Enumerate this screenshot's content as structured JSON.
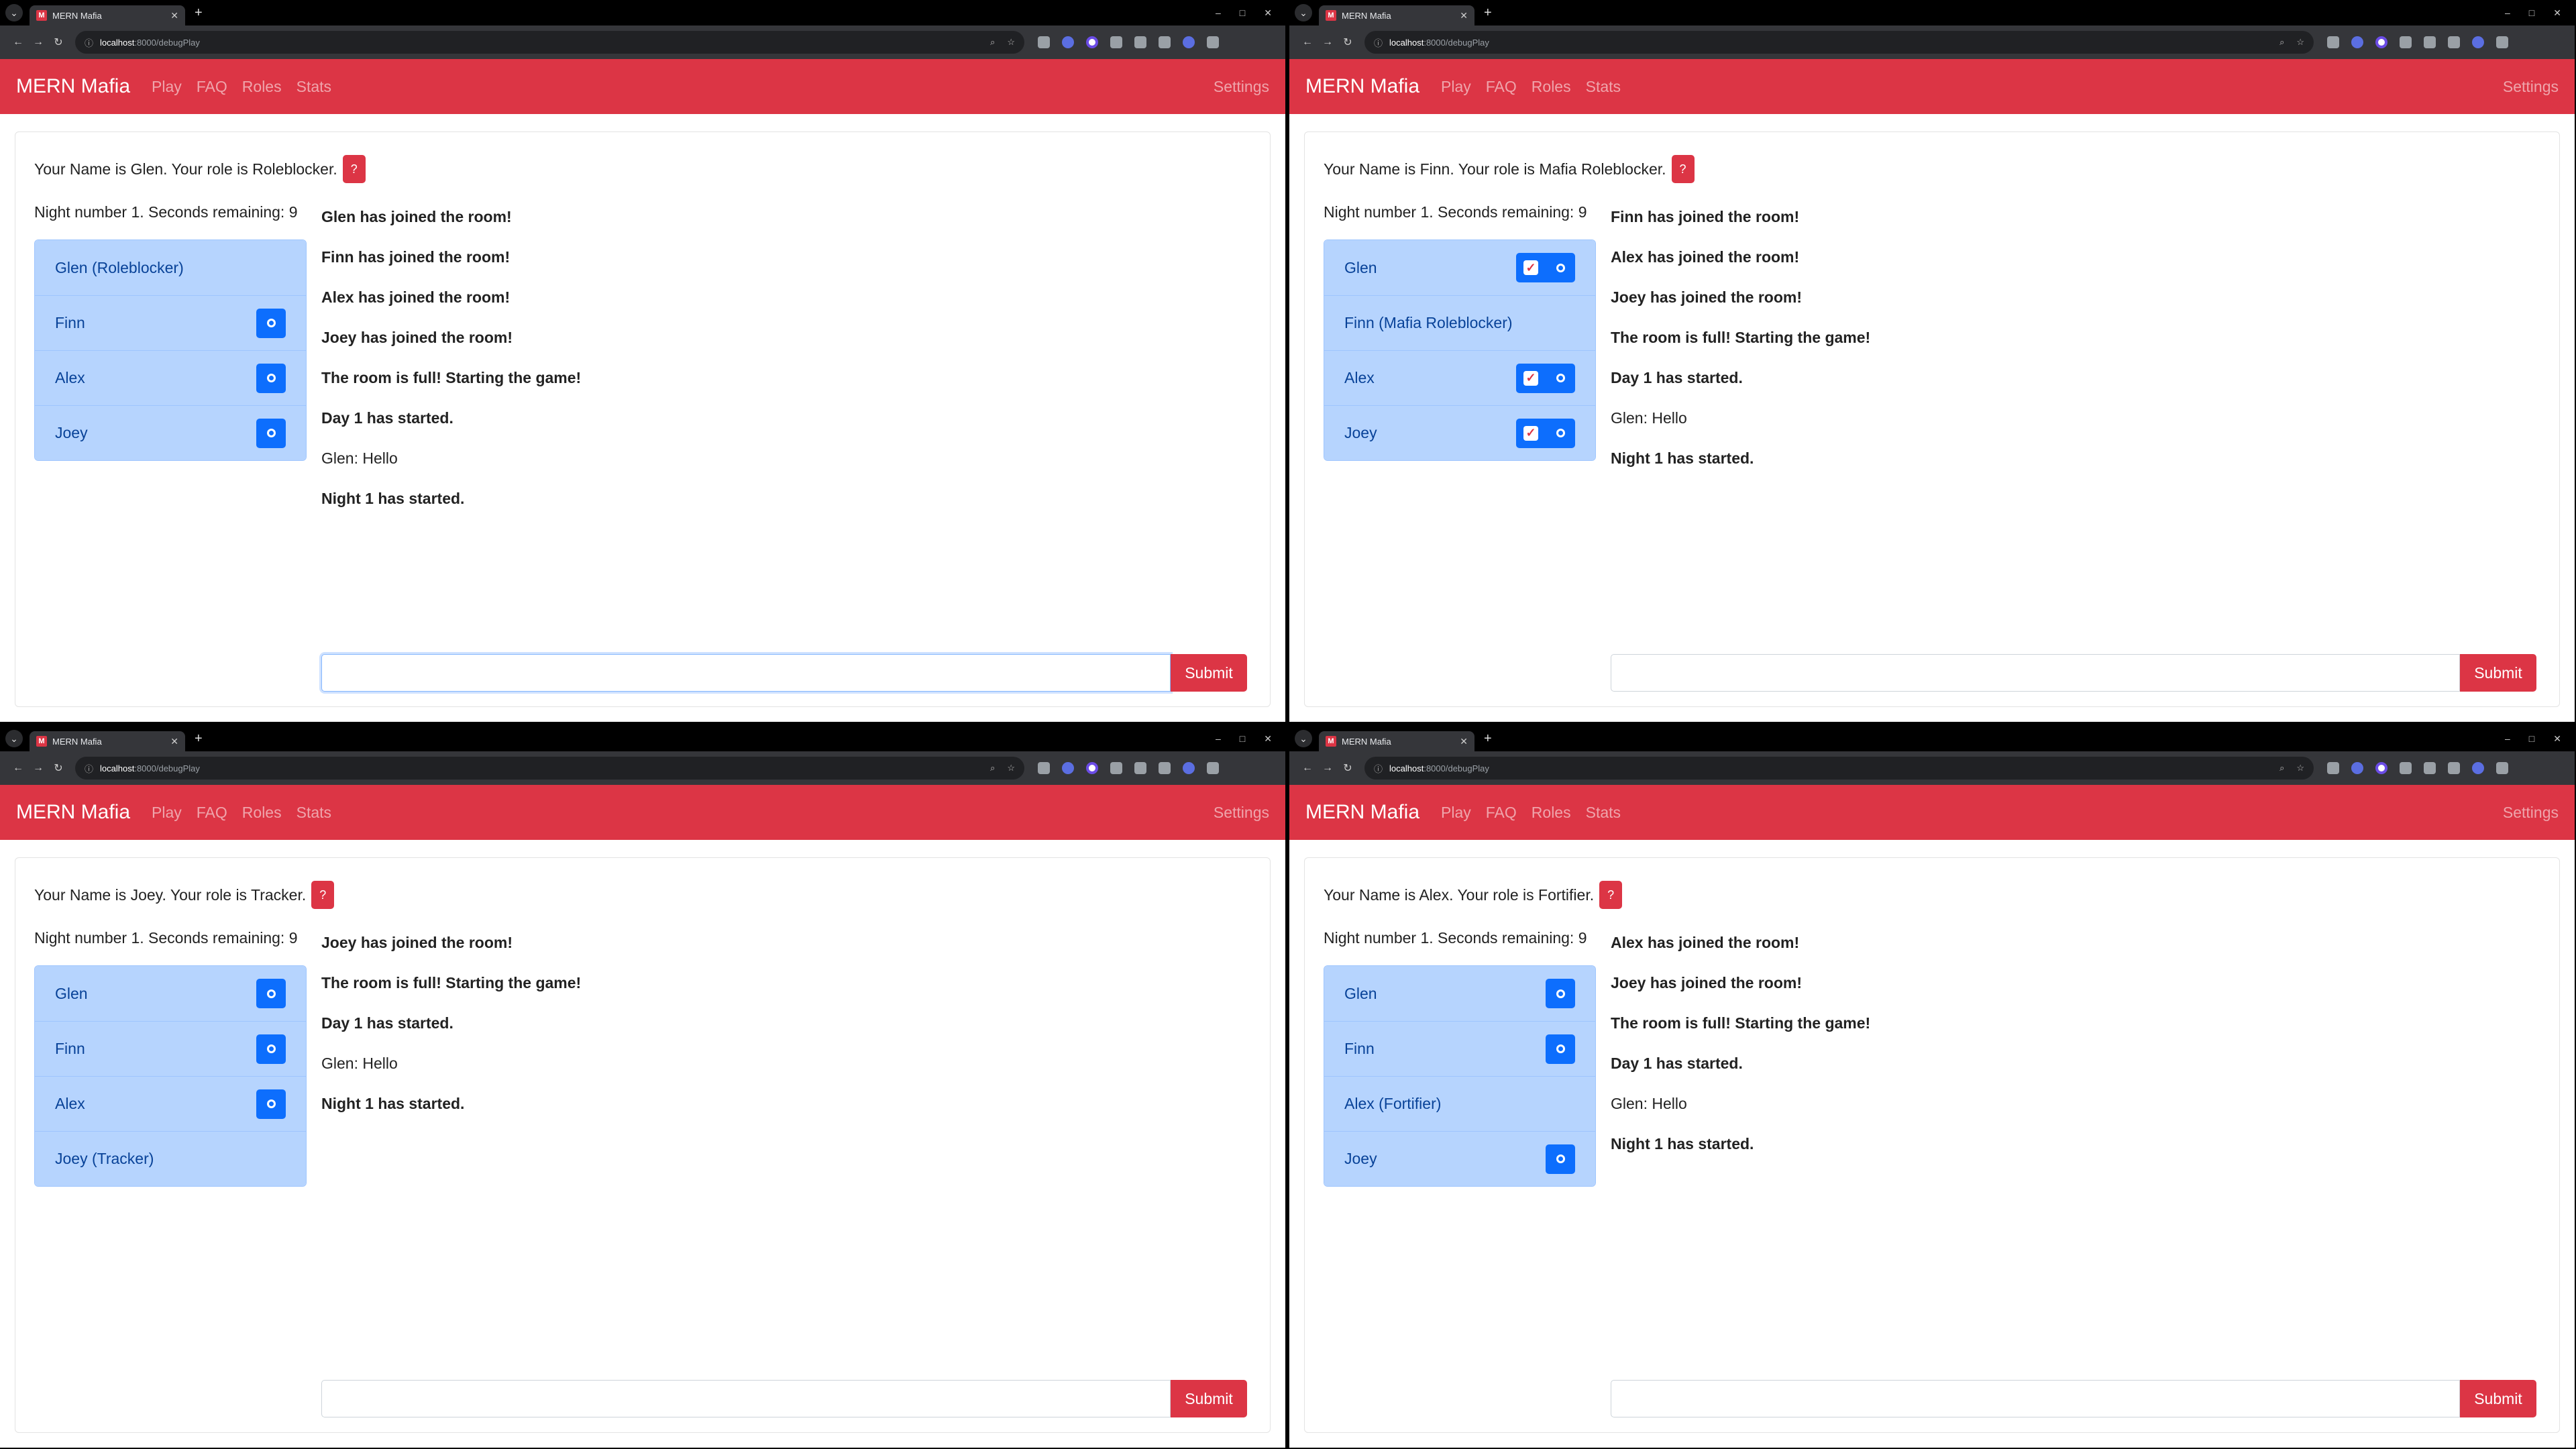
{
  "browser": {
    "tab_title": "MERN Mafia",
    "favicon_letter": "M",
    "url_host": "localhost",
    "url_path": ":8000/debugPlay",
    "new_tab_label": "+",
    "window_controls": [
      "–",
      "□",
      "✕"
    ]
  },
  "app": {
    "brand": "MERN Mafia",
    "nav": [
      "Play",
      "FAQ",
      "Roles",
      "Stats"
    ],
    "settings": "Settings",
    "help_label": "?",
    "submit_label": "Submit"
  },
  "windows": [
    {
      "role_text": "Your Name is Glen. Your role is Roleblocker.",
      "timer_text": "Night number 1. Seconds remaining: 9",
      "players": [
        {
          "name": "Glen (Roleblocker)",
          "buttons": []
        },
        {
          "name": "Finn",
          "buttons": [
            "target"
          ]
        },
        {
          "name": "Alex",
          "buttons": [
            "target"
          ]
        },
        {
          "name": "Joey",
          "buttons": [
            "target"
          ]
        }
      ],
      "messages": [
        {
          "text": "Glen has joined the room!",
          "bold": true
        },
        {
          "text": "Finn has joined the room!",
          "bold": true
        },
        {
          "text": "Alex has joined the room!",
          "bold": true
        },
        {
          "text": "Joey has joined the room!",
          "bold": true
        },
        {
          "text": "The room is full! Starting the game!",
          "bold": true
        },
        {
          "text": "Day 1 has started.",
          "bold": true
        },
        {
          "text": "Glen: Hello",
          "bold": false
        },
        {
          "text": "Night 1 has started.",
          "bold": true
        }
      ],
      "input_value": "",
      "input_focused": true
    },
    {
      "role_text": "Your Name is Finn. Your role is Mafia Roleblocker.",
      "timer_text": "Night number 1. Seconds remaining: 9",
      "players": [
        {
          "name": "Glen",
          "buttons": [
            "vote",
            "target"
          ]
        },
        {
          "name": "Finn (Mafia Roleblocker)",
          "buttons": []
        },
        {
          "name": "Alex",
          "buttons": [
            "vote",
            "target"
          ]
        },
        {
          "name": "Joey",
          "buttons": [
            "vote",
            "target"
          ]
        }
      ],
      "messages": [
        {
          "text": "Finn has joined the room!",
          "bold": true
        },
        {
          "text": "Alex has joined the room!",
          "bold": true
        },
        {
          "text": "Joey has joined the room!",
          "bold": true
        },
        {
          "text": "The room is full! Starting the game!",
          "bold": true
        },
        {
          "text": "Day 1 has started.",
          "bold": true
        },
        {
          "text": "Glen: Hello",
          "bold": false
        },
        {
          "text": "Night 1 has started.",
          "bold": true
        }
      ],
      "input_value": "",
      "input_focused": false
    },
    {
      "role_text": "Your Name is Joey. Your role is Tracker.",
      "timer_text": "Night number 1. Seconds remaining: 9",
      "players": [
        {
          "name": "Glen",
          "buttons": [
            "target"
          ]
        },
        {
          "name": "Finn",
          "buttons": [
            "target"
          ]
        },
        {
          "name": "Alex",
          "buttons": [
            "target"
          ]
        },
        {
          "name": "Joey (Tracker)",
          "buttons": []
        }
      ],
      "messages": [
        {
          "text": "Joey has joined the room!",
          "bold": true
        },
        {
          "text": "The room is full! Starting the game!",
          "bold": true
        },
        {
          "text": "Day 1 has started.",
          "bold": true
        },
        {
          "text": "Glen: Hello",
          "bold": false
        },
        {
          "text": "Night 1 has started.",
          "bold": true
        }
      ],
      "input_value": "",
      "input_focused": false
    },
    {
      "role_text": "Your Name is Alex. Your role is Fortifier.",
      "timer_text": "Night number 1. Seconds remaining: 9",
      "players": [
        {
          "name": "Glen",
          "buttons": [
            "target"
          ]
        },
        {
          "name": "Finn",
          "buttons": [
            "target"
          ]
        },
        {
          "name": "Alex (Fortifier)",
          "buttons": []
        },
        {
          "name": "Joey",
          "buttons": [
            "target"
          ]
        }
      ],
      "messages": [
        {
          "text": "Alex has joined the room!",
          "bold": true
        },
        {
          "text": "Joey has joined the room!",
          "bold": true
        },
        {
          "text": "The room is full! Starting the game!",
          "bold": true
        },
        {
          "text": "Day 1 has started.",
          "bold": true
        },
        {
          "text": "Glen: Hello",
          "bold": false
        },
        {
          "text": "Night 1 has started.",
          "bold": true
        }
      ],
      "input_value": "",
      "input_focused": false
    }
  ],
  "colors": {
    "brand_red": "#dc3545",
    "player_bg": "#b6d4fe",
    "button_blue": "#0d6efd",
    "browser_dark": "#35363a"
  }
}
